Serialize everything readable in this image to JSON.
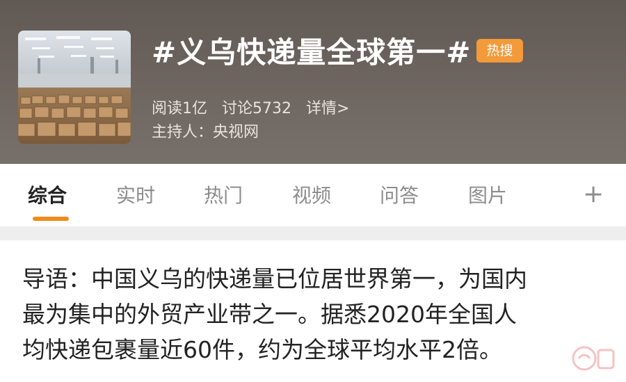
{
  "header": {
    "title": "#义乌快递量全球第一#",
    "badge": "热搜",
    "stats": {
      "read": "阅读1亿",
      "discussion": "讨论5732",
      "details": "详情>"
    },
    "host": "主持人：央视网"
  },
  "tabs": [
    {
      "label": "综合",
      "active": true
    },
    {
      "label": "实时",
      "active": false
    },
    {
      "label": "热门",
      "active": false
    },
    {
      "label": "视频",
      "active": false
    },
    {
      "label": "问答",
      "active": false
    },
    {
      "label": "图片",
      "active": false
    }
  ],
  "tab_add": "+",
  "intro": {
    "line1": "导语：中国义乌的快递量已位居世界第一，为国内",
    "line2": "最为集中的外贸产业带之一。据悉2020年全国人",
    "line3": "均快递包裹量近60件，约为全球平均水平2倍。"
  },
  "colors": {
    "accent": "#f28a1a",
    "badge": "#f39a3b",
    "header_bg": "#6a625d"
  }
}
